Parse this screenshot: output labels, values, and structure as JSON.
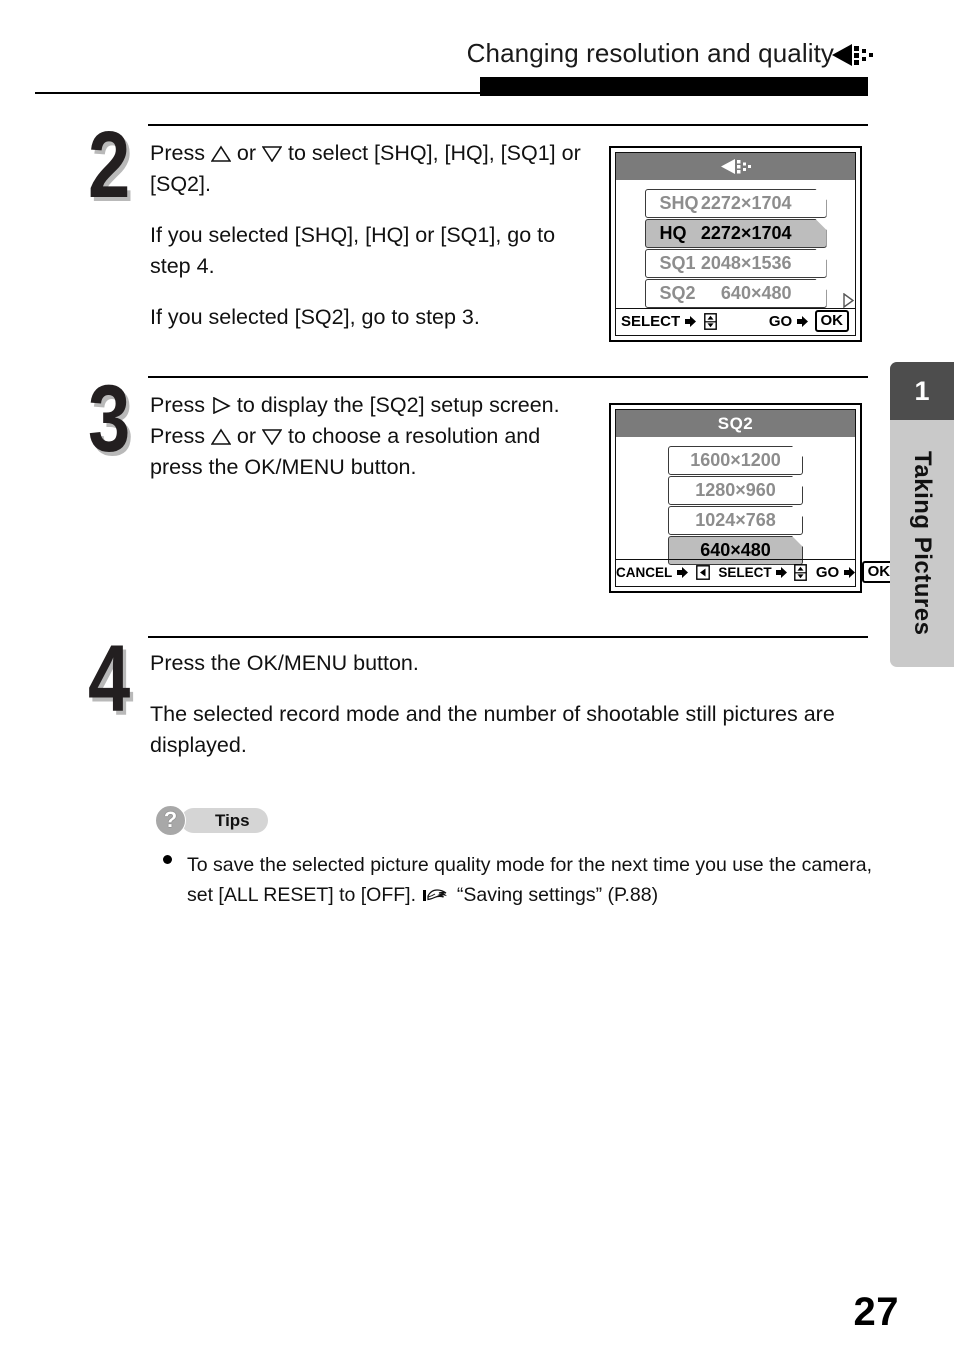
{
  "header": {
    "title": "Changing resolution and quality",
    "icon": "quality-triangle-icon"
  },
  "steps": [
    {
      "number": "2",
      "paragraphs": [
        {
          "segments": [
            {
              "type": "text",
              "text": "Press "
            },
            {
              "type": "icon",
              "icon": "up-triangle-icon"
            },
            {
              "type": "text",
              "text": " or "
            },
            {
              "type": "icon",
              "icon": "down-triangle-icon"
            },
            {
              "type": "text",
              "text": " to select [SHQ], [HQ], [SQ1] or [SQ2]."
            }
          ]
        },
        {
          "segments": [
            {
              "type": "text",
              "text": "If you selected [SHQ], [HQ] or [SQ1], go to step 4."
            }
          ]
        },
        {
          "segments": [
            {
              "type": "text",
              "text": "If you selected [SQ2], go to step 3."
            }
          ]
        }
      ]
    },
    {
      "number": "3",
      "paragraphs": [
        {
          "segments": [
            {
              "type": "text",
              "text": "Press "
            },
            {
              "type": "icon",
              "icon": "right-triangle-icon"
            },
            {
              "type": "text",
              "text": " to display the [SQ2] setup screen."
            }
          ]
        },
        {
          "segments": [
            {
              "type": "text",
              "text": "Press "
            },
            {
              "type": "icon",
              "icon": "up-triangle-icon"
            },
            {
              "type": "text",
              "text": " or "
            },
            {
              "type": "icon",
              "icon": "down-triangle-icon"
            },
            {
              "type": "text",
              "text": " to choose a resolution and press the OK/MENU button."
            }
          ]
        }
      ]
    },
    {
      "number": "4",
      "paragraphs": [
        {
          "segments": [
            {
              "type": "text",
              "text": "Press the OK/MENU button."
            }
          ]
        },
        {
          "segments": [
            {
              "type": "text",
              "text": "The selected record mode and the number of shootable still pictures are displayed."
            }
          ]
        }
      ]
    }
  ],
  "lcd_quality": {
    "title": "",
    "title_icon": "quality-triangle-icon",
    "rows": [
      {
        "label": "SHQ",
        "value": "2272×1704",
        "selected": false,
        "arrow": false
      },
      {
        "label": "HQ",
        "value": "2272×1704",
        "selected": true,
        "arrow": false
      },
      {
        "label": "SQ1",
        "value": "2048×1536",
        "selected": false,
        "arrow": false
      },
      {
        "label": "SQ2",
        "value": "640×480",
        "selected": false,
        "arrow": true
      }
    ],
    "footer": {
      "select_label": "SELECT",
      "go_label": "GO",
      "ok_label": "OK"
    }
  },
  "lcd_sq2": {
    "title": "SQ2",
    "rows": [
      {
        "value": "1600×1200",
        "selected": false
      },
      {
        "value": "1280×960",
        "selected": false
      },
      {
        "value": "1024×768",
        "selected": false
      },
      {
        "value": "640×480",
        "selected": true
      }
    ],
    "footer": {
      "cancel_label": "CANCEL",
      "select_label": "SELECT",
      "go_label": "GO",
      "ok_label": "OK"
    }
  },
  "tips": {
    "label": "Tips",
    "icon": "question-mark-icon",
    "item_part1": "To save the selected picture quality mode for the next time you use the camera, set [ALL RESET] to [OFF].",
    "item_ref": "“Saving settings” (P.88)",
    "ref_icon": "pointing-hand-icon"
  },
  "side_tab": {
    "number": "1",
    "label": "Taking Pictures"
  },
  "page_number": "27",
  "colors": {
    "selected_row": "#bdbdbd",
    "lcd_title_bar": "#7b7b7b",
    "side_tab_body": "#c9c9c9",
    "side_tab_num": "#4d4d4d",
    "tips_pill": "#d5d5d5"
  }
}
